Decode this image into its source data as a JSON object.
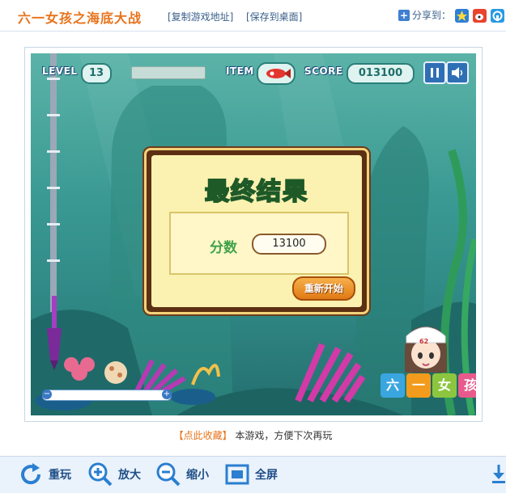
{
  "header": {
    "title": "六一女孩之海底大战",
    "copy_link": "[复制游戏地址]",
    "save_desktop": "[保存到桌面]",
    "share_label": "分享到："
  },
  "game": {
    "level_label": "LEVEL",
    "level_value": "13",
    "item_label": "ITEM",
    "score_label": "SCORE",
    "score_value": "013100",
    "dialog": {
      "title": "最终结果",
      "score_label": "分数",
      "score_value": "13100",
      "restart_label": "重新开始"
    },
    "logo_chars": [
      "六",
      "一",
      "女",
      "孩"
    ],
    "logo_colors": [
      "#3aa6e0",
      "#f29b1c",
      "#8cc63f",
      "#e85a8c"
    ],
    "player_badge": "62"
  },
  "caption": {
    "link": "【点此收藏】",
    "text": "本游戏，方便下次再玩"
  },
  "toolbar": {
    "replay": "重玩",
    "zoom_in": "放大",
    "zoom_out": "缩小",
    "fullscreen": "全屏"
  },
  "colors": {
    "accent": "#e8731b",
    "link": "#3a5f8a",
    "toolbar_text": "#1f4e86"
  }
}
